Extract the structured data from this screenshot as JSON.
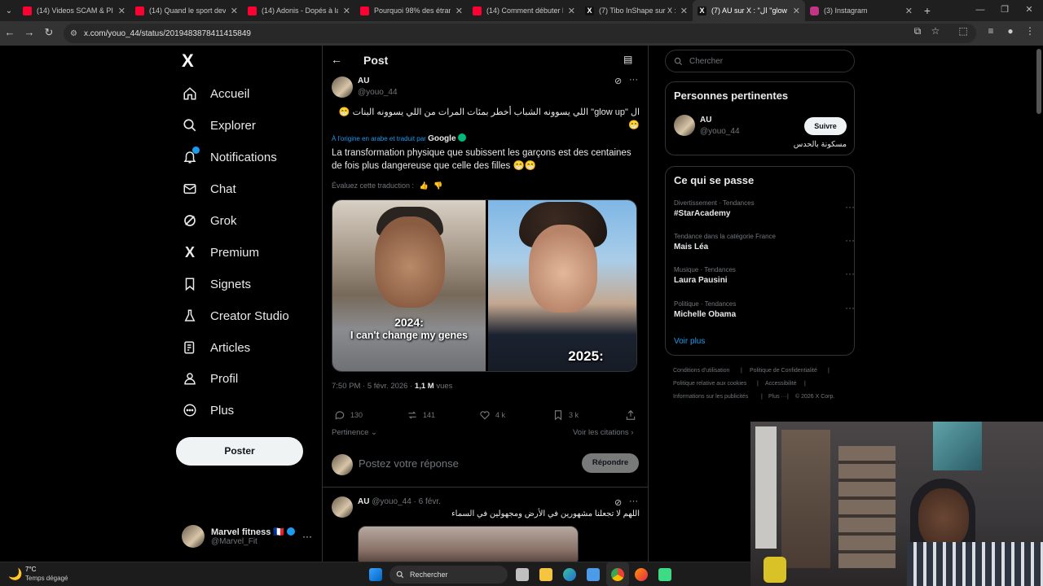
{
  "browser": {
    "tabs": [
      {
        "title": "(14) Videos SCAM & PICK",
        "icon": "youtube-icon"
      },
      {
        "title": "(14) Quand le sport devient",
        "icon": "youtube-icon"
      },
      {
        "title": "(14) Adonis - Dopés à la n",
        "icon": "youtube-icon"
      },
      {
        "title": "Pourquoi 98% des étrange",
        "icon": "youtube-icon"
      },
      {
        "title": "(14) Comment débuter le",
        "icon": "youtube-icon"
      },
      {
        "title": "(7) Tibo InShape sur X : \"",
        "icon": "x-icon"
      },
      {
        "title": "(7) AU sur X : \"ال \"glow up",
        "icon": "x-icon",
        "active": true
      },
      {
        "title": "(3) Instagram",
        "icon": "instagram-icon"
      }
    ],
    "url": "x.com/youo_44/status/2019483878411415849"
  },
  "nav": {
    "logo": "X",
    "items": [
      {
        "label": "Accueil",
        "icon": "home-icon"
      },
      {
        "label": "Explorer",
        "icon": "search-icon"
      },
      {
        "label": "Notifications",
        "icon": "bell-icon"
      },
      {
        "label": "Chat",
        "icon": "mail-icon"
      },
      {
        "label": "Grok",
        "icon": "grok-icon"
      },
      {
        "label": "Premium",
        "icon": "x-premium-icon"
      },
      {
        "label": "Signets",
        "icon": "bookmark-icon"
      },
      {
        "label": "Creator Studio",
        "icon": "flask-icon"
      },
      {
        "label": "Articles",
        "icon": "article-icon"
      },
      {
        "label": "Profil",
        "icon": "person-icon"
      },
      {
        "label": "Plus",
        "icon": "more-circle-icon"
      }
    ],
    "post_button": "Poster",
    "account": {
      "name": "Marvel fitness 🇫🇷",
      "handle": "@Marvel_Fit"
    }
  },
  "post": {
    "header_title": "Post",
    "author": {
      "name": "AU",
      "handle": "@youo_44"
    },
    "text_ar_line1": "ال \"glow up\" اللي يسوونه الشباب أخطر بمئات المرات من اللي يسوونه البنات 😁",
    "text_ar_line2": "😁",
    "translated_by": "À l'origine en arabe et traduit par",
    "google": "Google",
    "text_fr": "La transformation physique que subissent les garçons est des centaines de fois plus dangereuse que celle des filles 😁😁",
    "rate_translation": "Évaluez cette traduction :",
    "image_caption_left_1": "2024:",
    "image_caption_left_2": "I can't change my genes",
    "image_caption_right": "2025:",
    "time": "7:50 PM · 5 févr. 2026 ·",
    "views_count": "1,1 M",
    "views_label": "vues",
    "replies": "130",
    "reposts": "141",
    "likes": "4 k",
    "bookmarks": "3 k",
    "sort_label": "Pertinence",
    "quotes_link": "Voir les citations",
    "reply_placeholder": "Postez votre réponse",
    "reply_button": "Répondre"
  },
  "reply_tweet": {
    "name": "AU",
    "handle": "@youo_44",
    "date": "· 6 févr.",
    "text": "اللهم لا تجعلنا مشهورين في الأرض ومجهولين في السماء"
  },
  "right": {
    "search_placeholder": "Chercher",
    "relevant_title": "Personnes pertinentes",
    "relevant_person": {
      "name": "AU",
      "handle": "@youo_44",
      "bio": "مسكونة بالحدس",
      "follow": "Suivre"
    },
    "trends_title": "Ce qui se passe",
    "trends": [
      {
        "category": "Divertissement · Tendances",
        "title": "#StarAcademy"
      },
      {
        "category": "Tendance dans la catégorie France",
        "title": "Mais Léa"
      },
      {
        "category": "Musique · Tendances",
        "title": "Laura Pausini"
      },
      {
        "category": "Politique · Tendances",
        "title": "Michelle Obama"
      }
    ],
    "show_more": "Voir plus",
    "footer": [
      "Conditions d'utilisation",
      "Politique de Confidentialité",
      "Politique relative aux cookies",
      "Accessibilité",
      "Informations sur les publicités",
      "Plus ···",
      "© 2026 X Corp."
    ]
  },
  "taskbar": {
    "weather_temp": "7°C",
    "weather_desc": "Temps dégagé",
    "search_label": "Rechercher"
  },
  "colors": {
    "accent": "#1d9bf0",
    "background": "#000000",
    "muted": "#71767b",
    "border": "#2f3336"
  }
}
